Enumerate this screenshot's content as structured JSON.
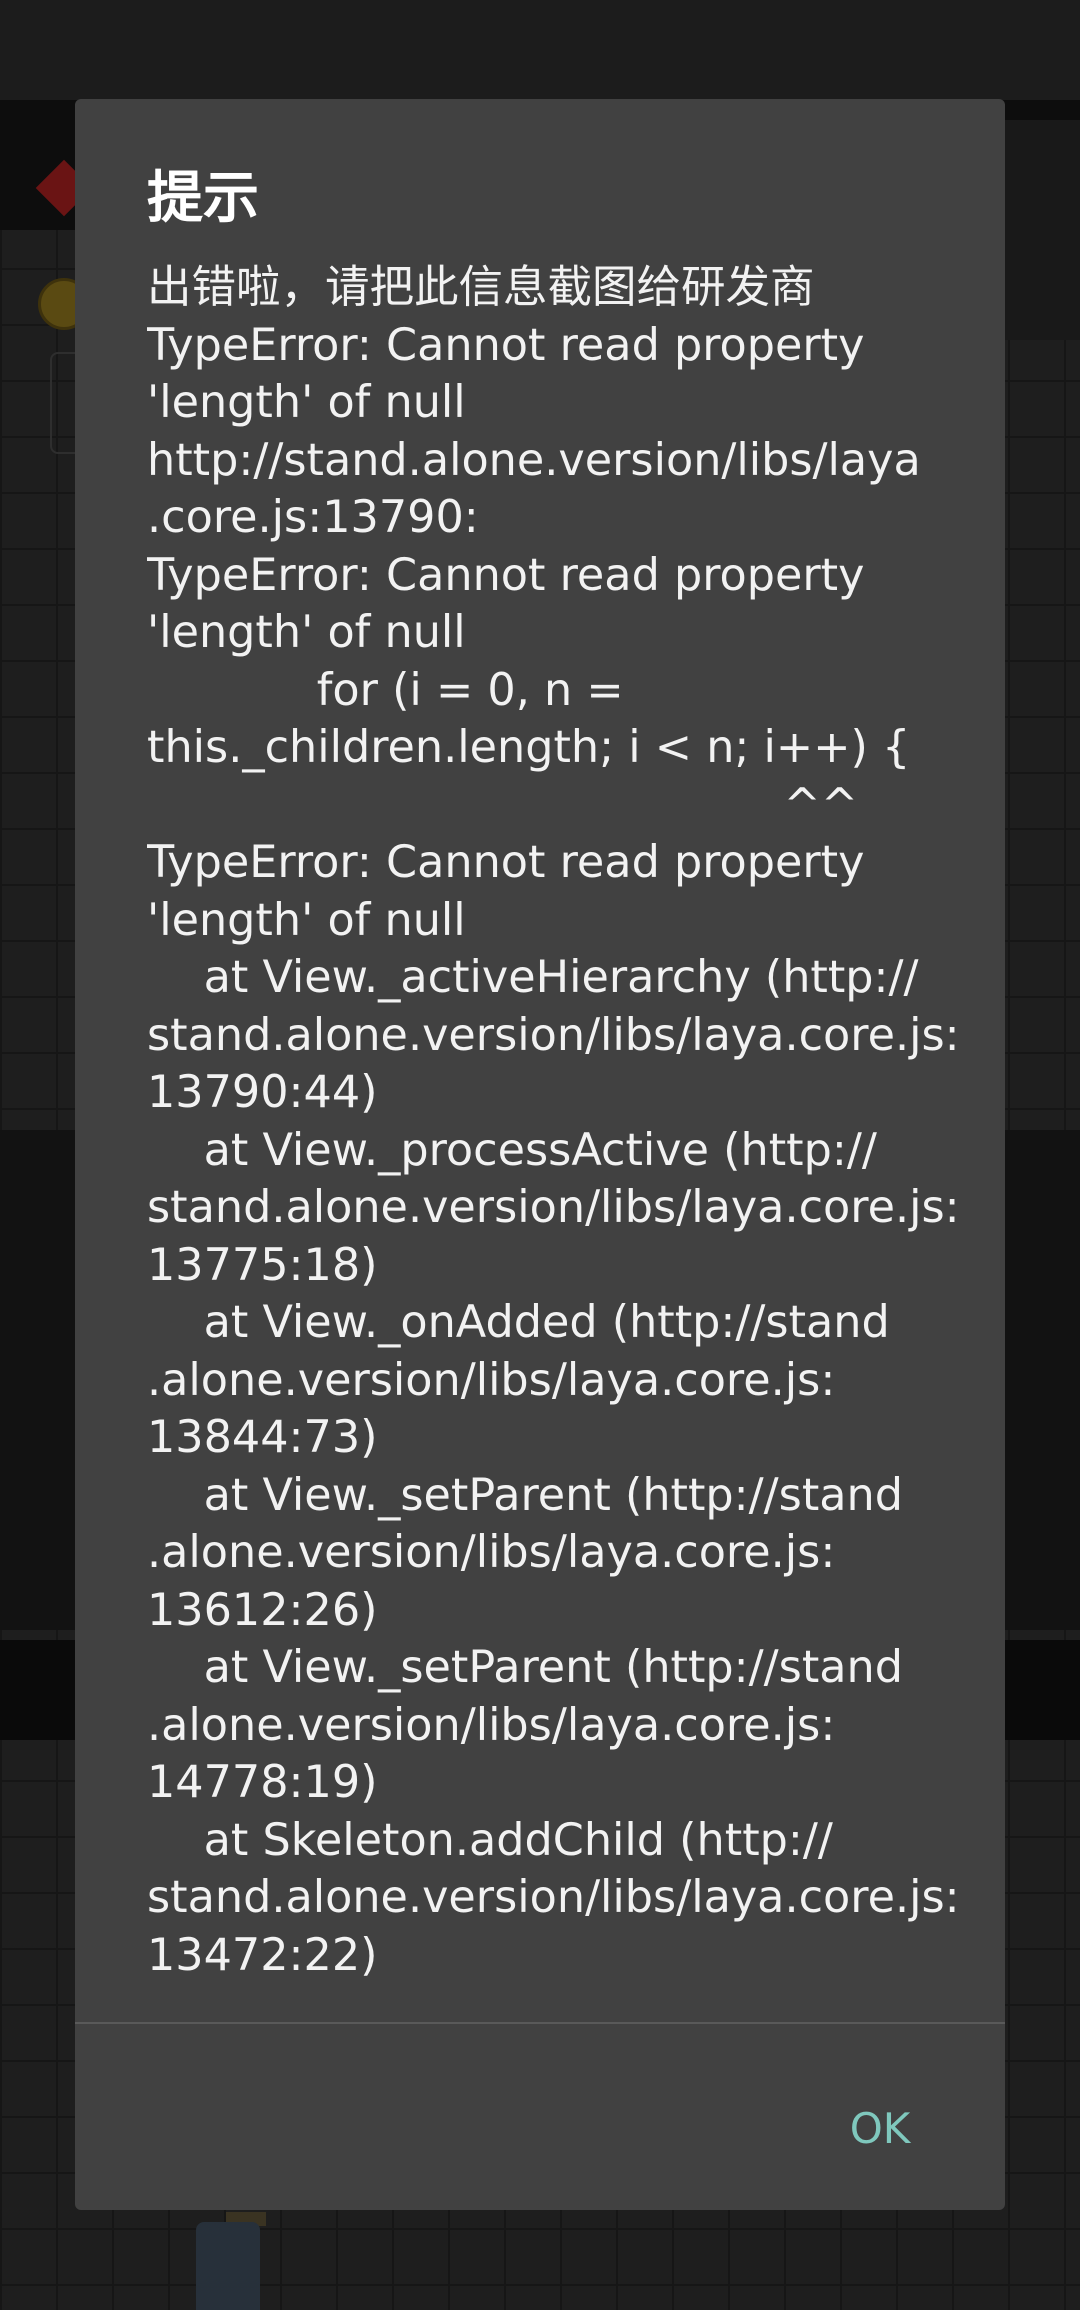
{
  "dialog": {
    "title": "提示",
    "message_lines": [
      "出错啦，请把此信息截图给研发商",
      "TypeError: Cannot read property",
      "'length' of null",
      "http://stand.alone.version/libs/laya",
      ".core.js:13790:",
      "TypeError: Cannot read property",
      "'length' of null",
      "            for (i = 0, n =",
      "this._children.length; i < n; i++) {",
      "                                             ^^",
      "TypeError: Cannot read property",
      "'length' of null",
      "    at View._activeHierarchy (http://",
      "stand.alone.version/libs/laya.core.js:",
      "13790:44)",
      "    at View._processActive (http://",
      "stand.alone.version/libs/laya.core.js:",
      "13775:18)",
      "    at View._onAdded (http://stand",
      ".alone.version/libs/laya.core.js:",
      "13844:73)",
      "    at View._setParent (http://stand",
      ".alone.version/libs/laya.core.js:",
      "13612:26)",
      "    at View._setParent (http://stand",
      ".alone.version/libs/laya.core.js:",
      "14778:19)",
      "    at Skeleton.addChild (http://",
      "stand.alone.version/libs/laya.core.js:",
      "13472:22)"
    ],
    "ok_label": "OK"
  },
  "colors": {
    "dialog_background": "#414141",
    "accent": "#7fc8bd",
    "text": "#f2f2f2"
  }
}
